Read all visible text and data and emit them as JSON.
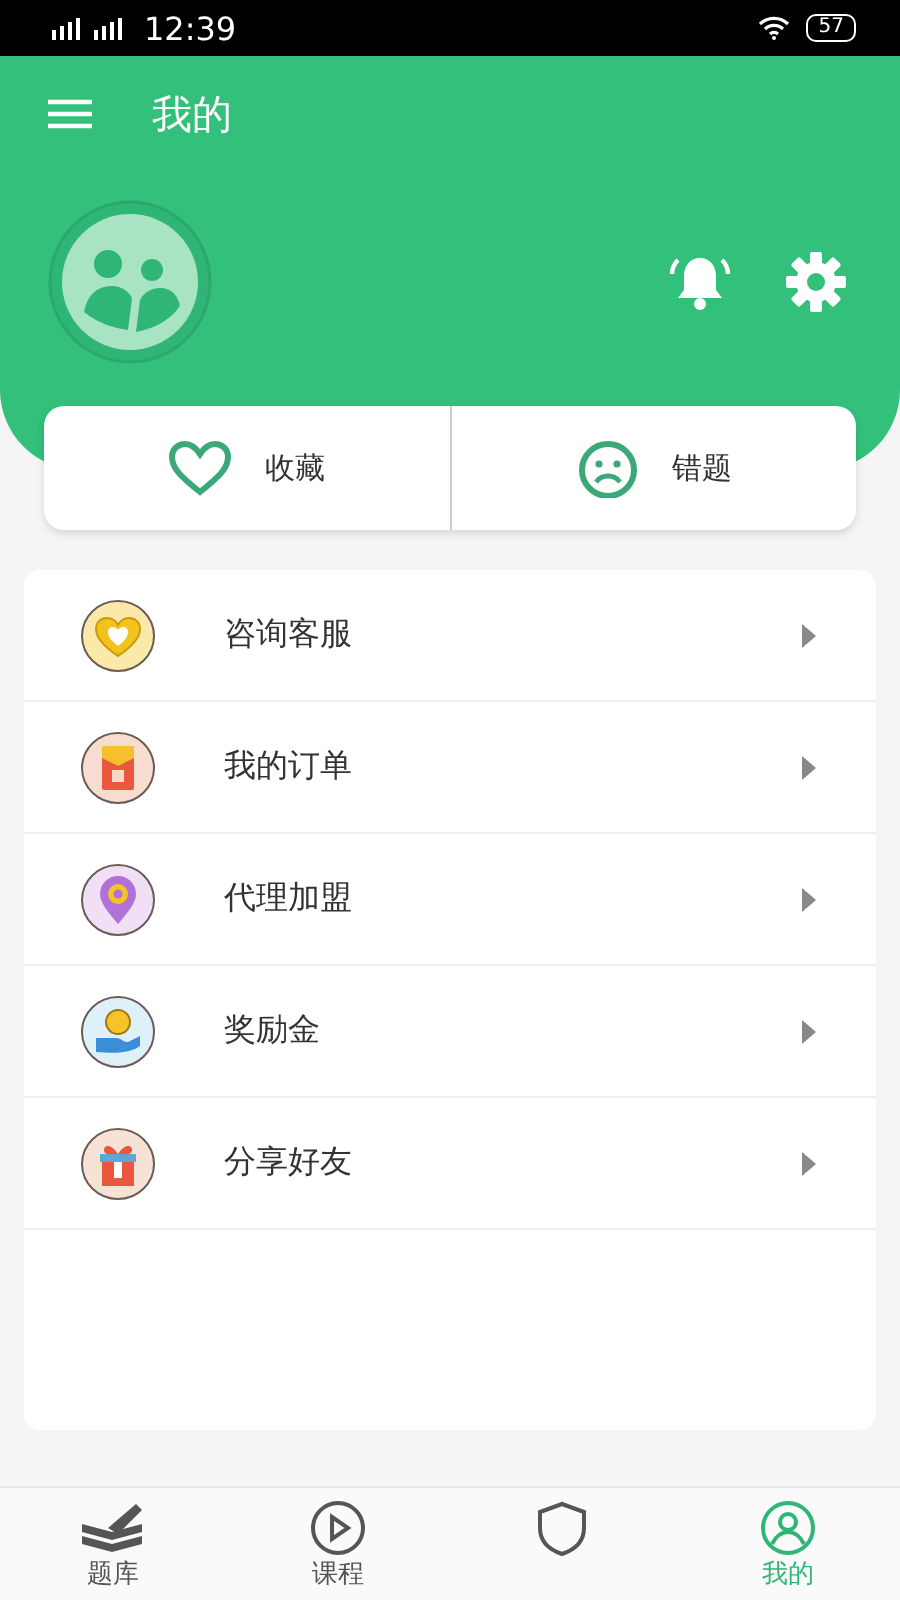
{
  "status_bar": {
    "time": "12:39",
    "battery": "57"
  },
  "header": {
    "title": "我的"
  },
  "quick_actions": [
    {
      "kind": "heart",
      "label": "收藏"
    },
    {
      "kind": "sad",
      "label": "错题"
    }
  ],
  "menu": [
    {
      "kind": "service",
      "label": "咨询客服"
    },
    {
      "kind": "order",
      "label": "我的订单"
    },
    {
      "kind": "agent",
      "label": "代理加盟"
    },
    {
      "kind": "reward",
      "label": "奖励金"
    },
    {
      "kind": "share",
      "label": "分享好友"
    }
  ],
  "tabs": [
    {
      "kind": "book",
      "label": "题库",
      "selected": false
    },
    {
      "kind": "play",
      "label": "课程",
      "selected": false
    },
    {
      "kind": "shield",
      "selected": false
    },
    {
      "kind": "person",
      "label": "我的",
      "selected": true
    }
  ]
}
